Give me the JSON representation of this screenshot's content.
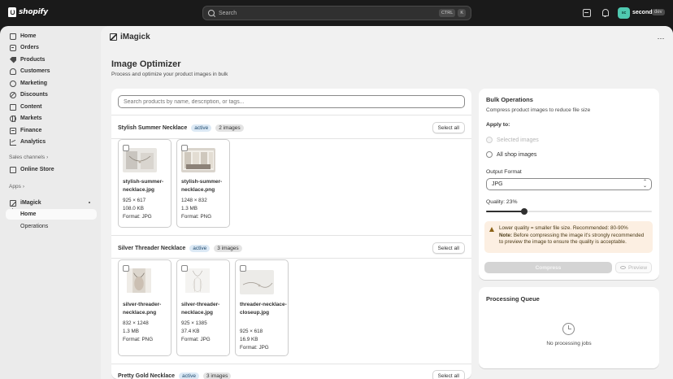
{
  "topbar": {
    "brand": "shopify",
    "search_placeholder": "Search",
    "shortcut_keys": [
      "CTRL",
      "K"
    ],
    "store_initials": "sc",
    "store_name": "second",
    "store_badge": "dev"
  },
  "sidebar": {
    "items": [
      {
        "label": "Home",
        "icon": "home-icon"
      },
      {
        "label": "Orders",
        "icon": "orders-icon"
      },
      {
        "label": "Products",
        "icon": "products-icon"
      },
      {
        "label": "Customers",
        "icon": "customers-icon"
      },
      {
        "label": "Marketing",
        "icon": "marketing-icon"
      },
      {
        "label": "Discounts",
        "icon": "discounts-icon"
      },
      {
        "label": "Content",
        "icon": "content-icon"
      },
      {
        "label": "Markets",
        "icon": "markets-icon"
      },
      {
        "label": "Finance",
        "icon": "finance-icon"
      },
      {
        "label": "Analytics",
        "icon": "analytics-icon"
      }
    ],
    "sales_channels_label": "Sales channels",
    "online_store": "Online Store",
    "apps_label": "Apps",
    "app_name": "iMagick",
    "app_sub_items": [
      "Home",
      "Operations"
    ]
  },
  "app_header": {
    "title": "iMagick",
    "more": "⋯"
  },
  "page": {
    "title": "Image Optimizer",
    "subtitle": "Process and optimize your product images in bulk"
  },
  "products": {
    "search_placeholder": "Search products by name, description, or tags...",
    "select_all_label": "Select all",
    "groups": [
      {
        "name": "Stylish Summer Necklace",
        "status": "active",
        "count": "2 images",
        "images": [
          {
            "name": "stylish-summer-necklace.jpg",
            "dims": "925 × 617",
            "size": "108.0 KB",
            "format": "Format: JPG"
          },
          {
            "name": "stylish-summer-necklace.png",
            "dims": "1248 × 832",
            "size": "1.3 MB",
            "format": "Format: PNG"
          }
        ]
      },
      {
        "name": "Silver Threader Necklace",
        "status": "active",
        "count": "3 images",
        "images": [
          {
            "name": "silver-threader-necklace.png",
            "dims": "832 × 1248",
            "size": "1.3 MB",
            "format": "Format: PNG"
          },
          {
            "name": "silver-threader-necklace.jpg",
            "dims": "925 × 1385",
            "size": "37.4 KB",
            "format": "Format: JPG"
          },
          {
            "name": "threader-necklace-closeup.jpg",
            "dims": "925 × 618",
            "size": "16.9 KB",
            "format": "Format: JPG"
          }
        ]
      },
      {
        "name": "Pretty Gold Necklace",
        "status": "active",
        "count": "3 images"
      }
    ]
  },
  "bulk": {
    "title": "Bulk Operations",
    "subtitle": "Compress product images to reduce file size",
    "apply_to": "Apply to:",
    "option_selected": "Selected images",
    "option_all": "All shop images",
    "output_format_label": "Output Format",
    "output_format_value": "JPG",
    "quality_label": "Quality: 23%",
    "quality_value": 0.23,
    "warning_line1": "Lower quality = smaller file size. Recommended: 80-90%",
    "warning_note_label": "Note:",
    "warning_note": "Before compressing the image it's strongly recommended to preview the image to ensure the quality is acceptable.",
    "compress_label": "Compress",
    "preview_label": "Preview"
  },
  "queue": {
    "title": "Processing Queue",
    "empty": "No processing jobs"
  },
  "colors": {
    "topbar": "#1a1a1a",
    "canvas": "#f1f1f1",
    "badge_active_bg": "#dce9f5",
    "warning_bg": "#fcefe2"
  }
}
